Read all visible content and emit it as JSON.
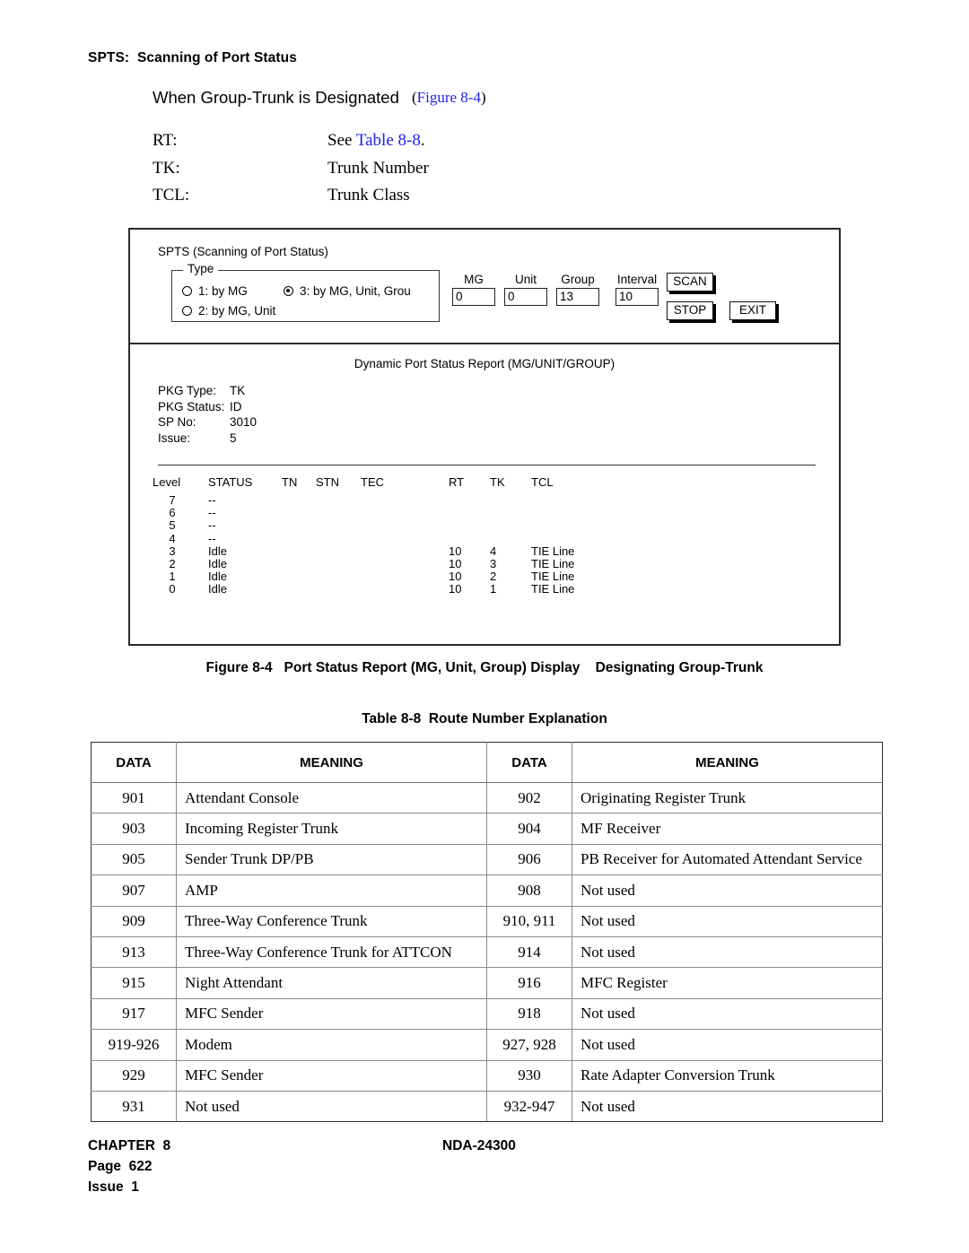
{
  "page_header": "SPTS:  Scanning of Port Status",
  "intro": {
    "title_text": "When Group-Trunk is Designated",
    "title_ref_open": "(",
    "title_ref_link": "Figure 8-4",
    "title_ref_close": ")",
    "definitions": [
      {
        "term": "RT:",
        "desc_prefix": "See ",
        "desc_link": "Table 8-8",
        "desc_suffix": "."
      },
      {
        "term": "TK:",
        "desc_prefix": "Trunk Number",
        "desc_link": "",
        "desc_suffix": ""
      },
      {
        "term": "TCL:",
        "desc_prefix": "Trunk Class",
        "desc_link": "",
        "desc_suffix": ""
      }
    ]
  },
  "dialog": {
    "title": "SPTS (Scanning of Port Status)",
    "type_group": {
      "legend": "Type",
      "options": [
        {
          "label": "1: by MG",
          "selected": false
        },
        {
          "label": "2: by MG, Unit",
          "selected": false
        },
        {
          "label": "3: by MG, Unit, Grou",
          "selected": true
        }
      ]
    },
    "fields": [
      {
        "label": "MG",
        "value": "0"
      },
      {
        "label": "Unit",
        "value": "0"
      },
      {
        "label": "Group",
        "value": "13"
      },
      {
        "label": "Interval",
        "value": "10"
      }
    ],
    "buttons": [
      {
        "label": "SCAN"
      },
      {
        "label": "STOP"
      },
      {
        "label": "EXIT"
      }
    ],
    "report": {
      "title": "Dynamic Port Status Report (MG/UNIT/GROUP)",
      "meta": [
        {
          "key": "PKG Type:",
          "value": "TK"
        },
        {
          "key": "PKG Status:",
          "value": "ID"
        },
        {
          "key": "SP No:",
          "value": "3010"
        },
        {
          "key": "Issue:",
          "value": "5"
        }
      ],
      "columns": [
        "Level",
        "STATUS",
        "TN",
        "STN",
        "TEC",
        "RT",
        "TK",
        "TCL"
      ],
      "rows": [
        {
          "level": "7",
          "status": "--",
          "tn": "",
          "stn": "",
          "tec": "",
          "rt": "",
          "tk": "",
          "tcl": ""
        },
        {
          "level": "6",
          "status": "--",
          "tn": "",
          "stn": "",
          "tec": "",
          "rt": "",
          "tk": "",
          "tcl": ""
        },
        {
          "level": "5",
          "status": "--",
          "tn": "",
          "stn": "",
          "tec": "",
          "rt": "",
          "tk": "",
          "tcl": ""
        },
        {
          "level": "4",
          "status": "--",
          "tn": "",
          "stn": "",
          "tec": "",
          "rt": "",
          "tk": "",
          "tcl": ""
        },
        {
          "level": "3",
          "status": "Idle",
          "tn": "",
          "stn": "",
          "tec": "",
          "rt": "10",
          "tk": "4",
          "tcl": "TIE Line"
        },
        {
          "level": "2",
          "status": "Idle",
          "tn": "",
          "stn": "",
          "tec": "",
          "rt": "10",
          "tk": "3",
          "tcl": "TIE Line"
        },
        {
          "level": "1",
          "status": "Idle",
          "tn": "",
          "stn": "",
          "tec": "",
          "rt": "10",
          "tk": "2",
          "tcl": "TIE Line"
        },
        {
          "level": "0",
          "status": "Idle",
          "tn": "",
          "stn": "",
          "tec": "",
          "rt": "10",
          "tk": "1",
          "tcl": "TIE Line"
        }
      ]
    }
  },
  "figure_caption": "Figure 8-4   Port Status Report (MG, Unit, Group) Display    Designating Group-Trunk",
  "table_caption": "Table 8-8  Route Number Explanation",
  "route_table": {
    "headers": [
      "DATA",
      "MEANING",
      "DATA",
      "MEANING"
    ],
    "rows": [
      [
        "901",
        "Attendant Console",
        "902",
        "Originating Register Trunk"
      ],
      [
        "903",
        "Incoming Register Trunk",
        "904",
        "MF Receiver"
      ],
      [
        "905",
        "Sender Trunk DP/PB",
        "906",
        "PB Receiver for Automated Attendant Service"
      ],
      [
        "907",
        "AMP",
        "908",
        "Not used"
      ],
      [
        "909",
        "Three-Way Conference Trunk",
        "910, 911",
        "Not used"
      ],
      [
        "913",
        "Three-Way Conference Trunk for ATTCON",
        "914",
        "Not used"
      ],
      [
        "915",
        "Night Attendant",
        "916",
        "MFC Register"
      ],
      [
        "917",
        "MFC Sender",
        "918",
        "Not used"
      ],
      [
        "919-926",
        "Modem",
        "927, 928",
        "Not used"
      ],
      [
        "929",
        "MFC Sender",
        "930",
        "Rate Adapter Conversion Trunk"
      ],
      [
        "931",
        "Not used",
        "932-947",
        "Not used"
      ]
    ]
  },
  "footer": {
    "chapter": "CHAPTER  8",
    "doc_number": "NDA-24300",
    "page": "Page  622",
    "issue": "Issue  1"
  }
}
